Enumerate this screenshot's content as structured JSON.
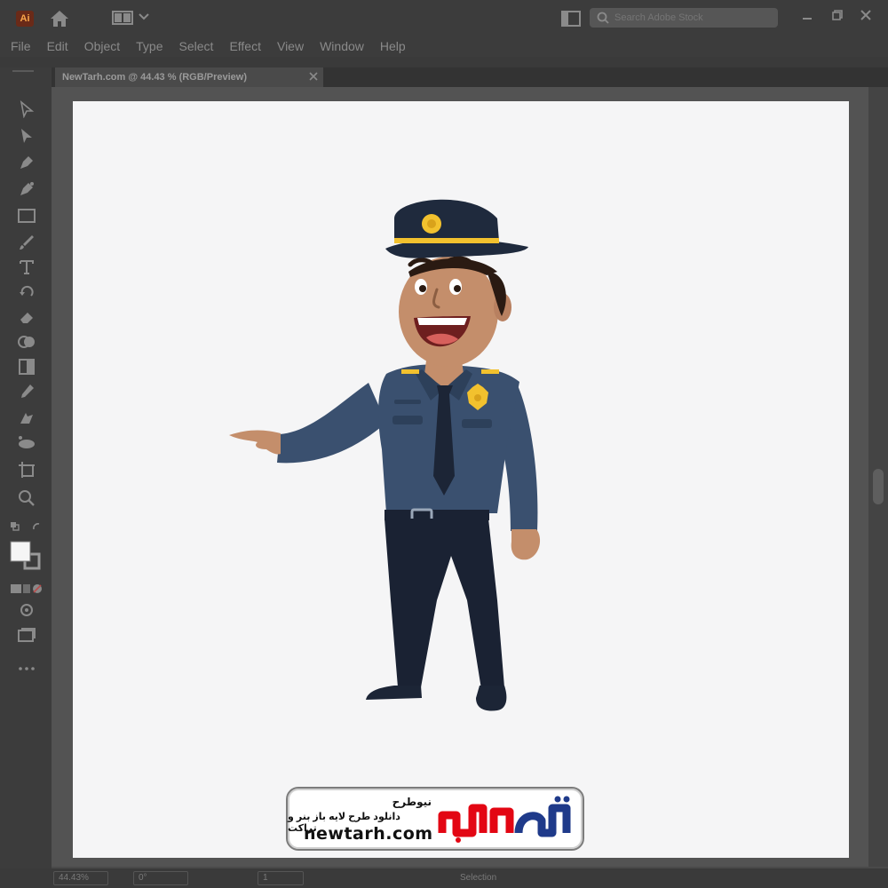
{
  "app": {
    "logo_text": "Ai"
  },
  "titlebar": {
    "search_placeholder": "Search Adobe Stock"
  },
  "menu": [
    "File",
    "Edit",
    "Object",
    "Type",
    "Select",
    "Effect",
    "View",
    "Window",
    "Help"
  ],
  "document_tab": {
    "label": "NewTarh.com @ 44.43 % (RGB/Preview)"
  },
  "statusbar": {
    "zoom": "44.43%",
    "angle": "0°",
    "artboard": "1",
    "tool": "Selection"
  },
  "watermark": {
    "title": "نیوطرح",
    "subtitle": "دانلود طرح لایه باز بنر و تراکت",
    "url": "newtarh.com",
    "logo_text": "نیوطرح"
  },
  "colors": {
    "uniform": "#3a506f",
    "uniform_dark": "#1f2a3d",
    "pants": "#1a2233",
    "badge": "#f2c12e",
    "skin": "#c48e6b",
    "logo_red": "#e30613",
    "logo_blue": "#1f3a8a"
  }
}
